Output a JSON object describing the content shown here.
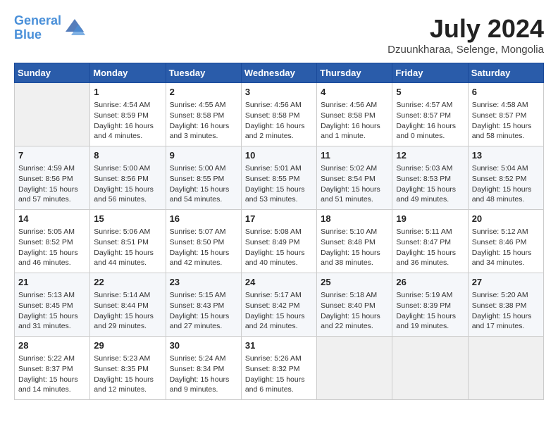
{
  "header": {
    "logo_line1": "General",
    "logo_line2": "Blue",
    "month": "July 2024",
    "location": "Dzuunkharaa, Selenge, Mongolia"
  },
  "weekdays": [
    "Sunday",
    "Monday",
    "Tuesday",
    "Wednesday",
    "Thursday",
    "Friday",
    "Saturday"
  ],
  "weeks": [
    [
      {
        "day": "",
        "info": ""
      },
      {
        "day": "1",
        "info": "Sunrise: 4:54 AM\nSunset: 8:59 PM\nDaylight: 16 hours\nand 4 minutes."
      },
      {
        "day": "2",
        "info": "Sunrise: 4:55 AM\nSunset: 8:58 PM\nDaylight: 16 hours\nand 3 minutes."
      },
      {
        "day": "3",
        "info": "Sunrise: 4:56 AM\nSunset: 8:58 PM\nDaylight: 16 hours\nand 2 minutes."
      },
      {
        "day": "4",
        "info": "Sunrise: 4:56 AM\nSunset: 8:58 PM\nDaylight: 16 hours\nand 1 minute."
      },
      {
        "day": "5",
        "info": "Sunrise: 4:57 AM\nSunset: 8:57 PM\nDaylight: 16 hours\nand 0 minutes."
      },
      {
        "day": "6",
        "info": "Sunrise: 4:58 AM\nSunset: 8:57 PM\nDaylight: 15 hours\nand 58 minutes."
      }
    ],
    [
      {
        "day": "7",
        "info": "Sunrise: 4:59 AM\nSunset: 8:56 PM\nDaylight: 15 hours\nand 57 minutes."
      },
      {
        "day": "8",
        "info": "Sunrise: 5:00 AM\nSunset: 8:56 PM\nDaylight: 15 hours\nand 56 minutes."
      },
      {
        "day": "9",
        "info": "Sunrise: 5:00 AM\nSunset: 8:55 PM\nDaylight: 15 hours\nand 54 minutes."
      },
      {
        "day": "10",
        "info": "Sunrise: 5:01 AM\nSunset: 8:55 PM\nDaylight: 15 hours\nand 53 minutes."
      },
      {
        "day": "11",
        "info": "Sunrise: 5:02 AM\nSunset: 8:54 PM\nDaylight: 15 hours\nand 51 minutes."
      },
      {
        "day": "12",
        "info": "Sunrise: 5:03 AM\nSunset: 8:53 PM\nDaylight: 15 hours\nand 49 minutes."
      },
      {
        "day": "13",
        "info": "Sunrise: 5:04 AM\nSunset: 8:52 PM\nDaylight: 15 hours\nand 48 minutes."
      }
    ],
    [
      {
        "day": "14",
        "info": "Sunrise: 5:05 AM\nSunset: 8:52 PM\nDaylight: 15 hours\nand 46 minutes."
      },
      {
        "day": "15",
        "info": "Sunrise: 5:06 AM\nSunset: 8:51 PM\nDaylight: 15 hours\nand 44 minutes."
      },
      {
        "day": "16",
        "info": "Sunrise: 5:07 AM\nSunset: 8:50 PM\nDaylight: 15 hours\nand 42 minutes."
      },
      {
        "day": "17",
        "info": "Sunrise: 5:08 AM\nSunset: 8:49 PM\nDaylight: 15 hours\nand 40 minutes."
      },
      {
        "day": "18",
        "info": "Sunrise: 5:10 AM\nSunset: 8:48 PM\nDaylight: 15 hours\nand 38 minutes."
      },
      {
        "day": "19",
        "info": "Sunrise: 5:11 AM\nSunset: 8:47 PM\nDaylight: 15 hours\nand 36 minutes."
      },
      {
        "day": "20",
        "info": "Sunrise: 5:12 AM\nSunset: 8:46 PM\nDaylight: 15 hours\nand 34 minutes."
      }
    ],
    [
      {
        "day": "21",
        "info": "Sunrise: 5:13 AM\nSunset: 8:45 PM\nDaylight: 15 hours\nand 31 minutes."
      },
      {
        "day": "22",
        "info": "Sunrise: 5:14 AM\nSunset: 8:44 PM\nDaylight: 15 hours\nand 29 minutes."
      },
      {
        "day": "23",
        "info": "Sunrise: 5:15 AM\nSunset: 8:43 PM\nDaylight: 15 hours\nand 27 minutes."
      },
      {
        "day": "24",
        "info": "Sunrise: 5:17 AM\nSunset: 8:42 PM\nDaylight: 15 hours\nand 24 minutes."
      },
      {
        "day": "25",
        "info": "Sunrise: 5:18 AM\nSunset: 8:40 PM\nDaylight: 15 hours\nand 22 minutes."
      },
      {
        "day": "26",
        "info": "Sunrise: 5:19 AM\nSunset: 8:39 PM\nDaylight: 15 hours\nand 19 minutes."
      },
      {
        "day": "27",
        "info": "Sunrise: 5:20 AM\nSunset: 8:38 PM\nDaylight: 15 hours\nand 17 minutes."
      }
    ],
    [
      {
        "day": "28",
        "info": "Sunrise: 5:22 AM\nSunset: 8:37 PM\nDaylight: 15 hours\nand 14 minutes."
      },
      {
        "day": "29",
        "info": "Sunrise: 5:23 AM\nSunset: 8:35 PM\nDaylight: 15 hours\nand 12 minutes."
      },
      {
        "day": "30",
        "info": "Sunrise: 5:24 AM\nSunset: 8:34 PM\nDaylight: 15 hours\nand 9 minutes."
      },
      {
        "day": "31",
        "info": "Sunrise: 5:26 AM\nSunset: 8:32 PM\nDaylight: 15 hours\nand 6 minutes."
      },
      {
        "day": "",
        "info": ""
      },
      {
        "day": "",
        "info": ""
      },
      {
        "day": "",
        "info": ""
      }
    ]
  ]
}
